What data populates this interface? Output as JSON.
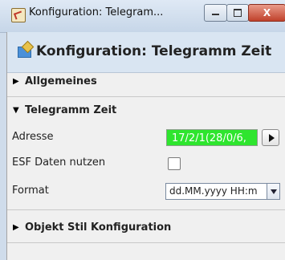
{
  "window": {
    "title": "Konfiguration: Telegram...",
    "close_label": "X"
  },
  "header": {
    "title": "Konfiguration: Telegramm Zeit"
  },
  "sections": {
    "allgemeines": {
      "label": "Allgemeines",
      "expanded": false
    },
    "telegramm_zeit": {
      "label": "Telegramm Zeit",
      "expanded": true
    },
    "objekt_stil": {
      "label": "Objekt Stil Konfiguration",
      "expanded": false
    }
  },
  "fields": {
    "adresse": {
      "label": "Adresse",
      "value": "17/2/1(28/0/6,",
      "color": "#2ee52e"
    },
    "esf": {
      "label": "ESF Daten nutzen",
      "checked": false
    },
    "format": {
      "label": "Format",
      "value": "dd.MM.yyyy HH:m"
    }
  }
}
